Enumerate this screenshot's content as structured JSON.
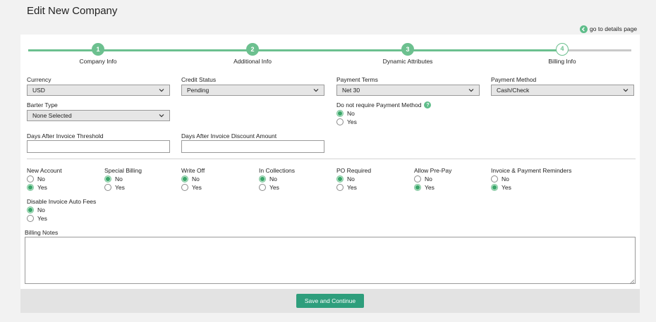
{
  "page": {
    "title": "Edit New Company"
  },
  "details_link": {
    "label": "go to details page"
  },
  "steps": [
    {
      "number": "1",
      "label": "Company Info",
      "state": "complete"
    },
    {
      "number": "2",
      "label": "Additional Info",
      "state": "complete"
    },
    {
      "number": "3",
      "label": "Dynamic Attributes",
      "state": "complete"
    },
    {
      "number": "4",
      "label": "Billing Info",
      "state": "current"
    }
  ],
  "fields": {
    "currency": {
      "label": "Currency",
      "value": "USD"
    },
    "credit_status": {
      "label": "Credit Status",
      "value": "Pending"
    },
    "payment_terms": {
      "label": "Payment Terms",
      "value": "Net 30"
    },
    "payment_method": {
      "label": "Payment Method",
      "value": "Cash/Check"
    },
    "barter_type": {
      "label": "Barter Type",
      "value": "None Selected"
    },
    "no_payment_method": {
      "label": "Do not require Payment Method",
      "options": [
        "No",
        "Yes"
      ],
      "selected": "No"
    },
    "days_threshold": {
      "label": "Days After Invoice Threshold",
      "value": ""
    },
    "days_discount": {
      "label": "Days After Invoice Discount Amount",
      "value": ""
    }
  },
  "radio_groups": [
    {
      "label": "New Account",
      "options": [
        "No",
        "Yes"
      ],
      "selected": "Yes"
    },
    {
      "label": "Special Billing",
      "options": [
        "No",
        "Yes"
      ],
      "selected": "No"
    },
    {
      "label": "Write Off",
      "options": [
        "No",
        "Yes"
      ],
      "selected": "No"
    },
    {
      "label": "In Collections",
      "options": [
        "No",
        "Yes"
      ],
      "selected": "No"
    },
    {
      "label": "PO Required",
      "options": [
        "No",
        "Yes"
      ],
      "selected": "No"
    },
    {
      "label": "Allow Pre-Pay",
      "options": [
        "No",
        "Yes"
      ],
      "selected": "Yes"
    },
    {
      "label": "Invoice & Payment Reminders",
      "options": [
        "No",
        "Yes"
      ],
      "selected": "Yes"
    },
    {
      "label": "Disable Invoice Auto Fees",
      "options": [
        "No",
        "Yes"
      ],
      "selected": "No"
    }
  ],
  "billing_notes": {
    "label": "Billing Notes",
    "value": ""
  },
  "footer": {
    "save_label": "Save and Continue"
  },
  "colors": {
    "accent": "#6cc08f",
    "button": "#2e9e7c"
  }
}
